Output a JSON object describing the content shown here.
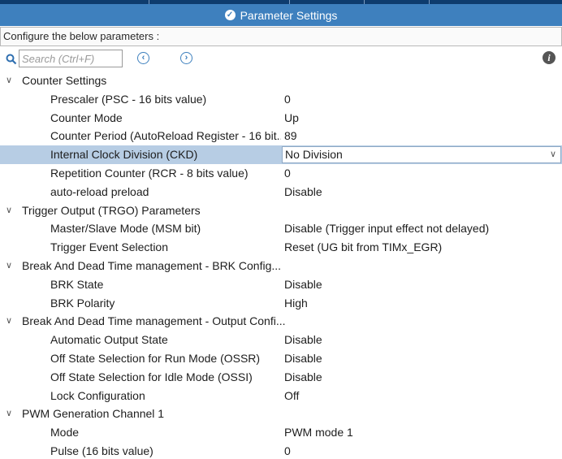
{
  "header": {
    "title": "Parameter Settings"
  },
  "configure": {
    "text": "Configure the below parameters :"
  },
  "toolbar": {
    "search_placeholder": "Search (Ctrl+F)"
  },
  "groups": [
    {
      "label": "Counter Settings",
      "params": [
        {
          "label": "Prescaler (PSC - 16 bits value)",
          "value": "0"
        },
        {
          "label": "Counter Mode",
          "value": "Up"
        },
        {
          "label": "Counter Period (AutoReload Register - 16 bit...",
          "value": "89"
        },
        {
          "label": "Internal Clock Division (CKD)",
          "value": "No Division",
          "selected": true
        },
        {
          "label": "Repetition Counter (RCR - 8 bits value)",
          "value": "0"
        },
        {
          "label": "auto-reload preload",
          "value": "Disable"
        }
      ]
    },
    {
      "label": "Trigger Output (TRGO) Parameters",
      "params": [
        {
          "label": "Master/Slave Mode (MSM bit)",
          "value": "Disable (Trigger input effect not delayed)"
        },
        {
          "label": "Trigger Event Selection",
          "value": "Reset (UG bit from TIMx_EGR)"
        }
      ]
    },
    {
      "label": "Break And Dead Time management - BRK Config...",
      "params": [
        {
          "label": "BRK State",
          "value": "Disable"
        },
        {
          "label": "BRK Polarity",
          "value": "High"
        }
      ]
    },
    {
      "label": "Break And Dead Time management - Output Confi...",
      "params": [
        {
          "label": "Automatic Output State",
          "value": "Disable"
        },
        {
          "label": "Off State Selection for Run Mode (OSSR)",
          "value": "Disable"
        },
        {
          "label": "Off State Selection for Idle Mode (OSSI)",
          "value": "Disable"
        },
        {
          "label": "Lock Configuration",
          "value": "Off"
        }
      ]
    },
    {
      "label": "PWM Generation Channel 1",
      "params": [
        {
          "label": "Mode",
          "value": "PWM mode 1"
        },
        {
          "label": "Pulse (16 bits value)",
          "value": "0"
        }
      ]
    }
  ]
}
